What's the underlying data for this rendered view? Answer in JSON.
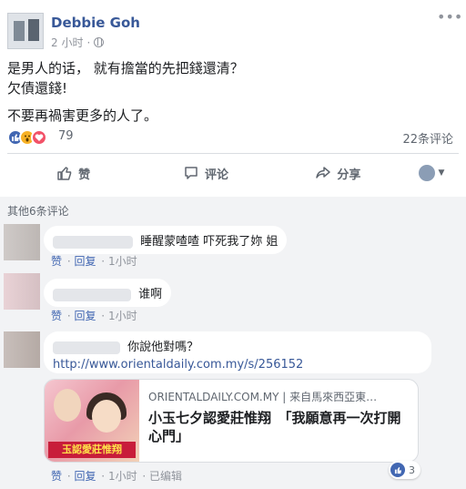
{
  "post": {
    "author": "Debbie Goh",
    "time": "2 小时",
    "lines": [
      "是男人的话， 就有擔當的先把錢還清？",
      "欠債還錢!",
      "不要再禍害更多的人了。"
    ],
    "reaction_count": "79",
    "comment_count": "22条评论"
  },
  "actions": {
    "like": "赞",
    "comment": "评论",
    "share": "分享"
  },
  "comments_section": {
    "more_comments": "其他6条评论",
    "comments": [
      {
        "text": "睡醒蒙喳喳 吓死我了妳 姐",
        "like": "赞",
        "reply": "回复",
        "time": "1小时"
      },
      {
        "text": "谁啊",
        "like": "赞",
        "reply": "回复",
        "time": "1小时"
      },
      {
        "text": "你說他對嗎？",
        "link": "http://www.orientaldaily.com.my/s/256152",
        "preview_domain": "ORIENTALDAILY.COM.MY | 来自馬來西亞東…",
        "preview_title": "小玉七夕認愛莊惟翔　「我願意再一次打開心門」",
        "preview_banner": "玉認愛莊惟翔",
        "like": "赞",
        "reply": "回复",
        "time": "1小时",
        "edited": "已编辑",
        "like_count": "3"
      }
    ]
  },
  "colors": {
    "brand": "#4267b2",
    "link": "#385898",
    "muted": "#606770"
  }
}
